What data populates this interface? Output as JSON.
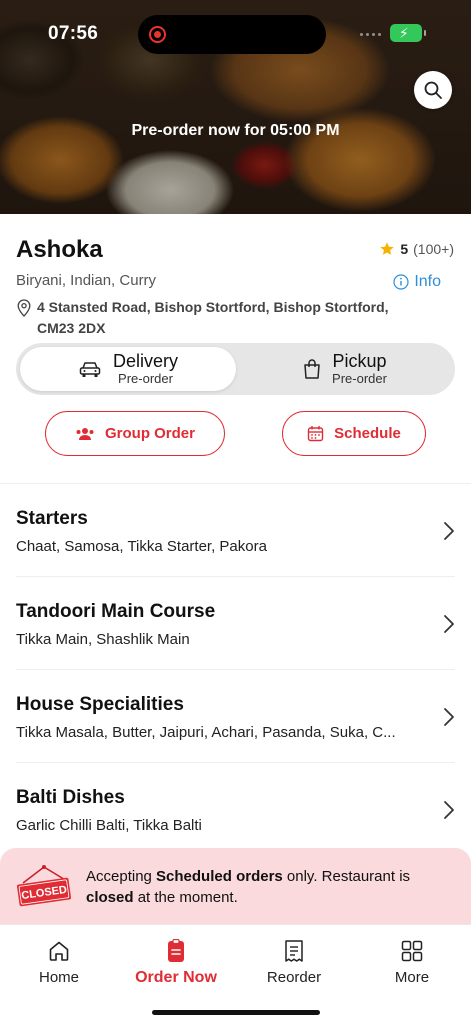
{
  "status_bar": {
    "time": "07:56"
  },
  "hero": {
    "preorder_text": "Pre-order now for 05:00 PM"
  },
  "restaurant": {
    "name": "Ashoka",
    "rating": "5",
    "rating_count": "(100+)",
    "cuisines": "Biryani, Indian, Curry",
    "info_label": "Info",
    "address": "4 Stansted Road, Bishop Stortford, Bishop Stortford, CM23 2DX"
  },
  "order_mode": {
    "delivery": {
      "label": "Delivery",
      "sub": "Pre-order"
    },
    "pickup": {
      "label": "Pickup",
      "sub": "Pre-order"
    }
  },
  "actions": {
    "group_order": "Group Order",
    "schedule": "Schedule"
  },
  "menu": [
    {
      "title": "Starters",
      "desc": "Chaat, Samosa, Tikka Starter, Pakora"
    },
    {
      "title": "Tandoori Main Course",
      "desc": "Tikka Main, Shashlik Main"
    },
    {
      "title": "House Specialities",
      "desc": "Tikka Masala, Butter, Jaipuri, Achari, Pasanda, Suka, C..."
    },
    {
      "title": "Balti Dishes",
      "desc": "Garlic Chilli Balti, Tikka Balti"
    }
  ],
  "closed_banner": {
    "sign": "CLOSED",
    "part1": "Accepting ",
    "bold1": "Scheduled orders",
    "part2": " only. Restaurant is ",
    "bold2": "closed",
    "part3": " at the moment."
  },
  "nav": [
    {
      "label": "Home",
      "icon": "home-icon"
    },
    {
      "label": "Order Now",
      "icon": "order-icon"
    },
    {
      "label": "Reorder",
      "icon": "receipt-icon"
    },
    {
      "label": "More",
      "icon": "grid-icon"
    }
  ],
  "colors": {
    "accent": "#e02d35",
    "link": "#2f8fd8",
    "banner_bg": "#fadadd",
    "star": "#f5b301"
  }
}
